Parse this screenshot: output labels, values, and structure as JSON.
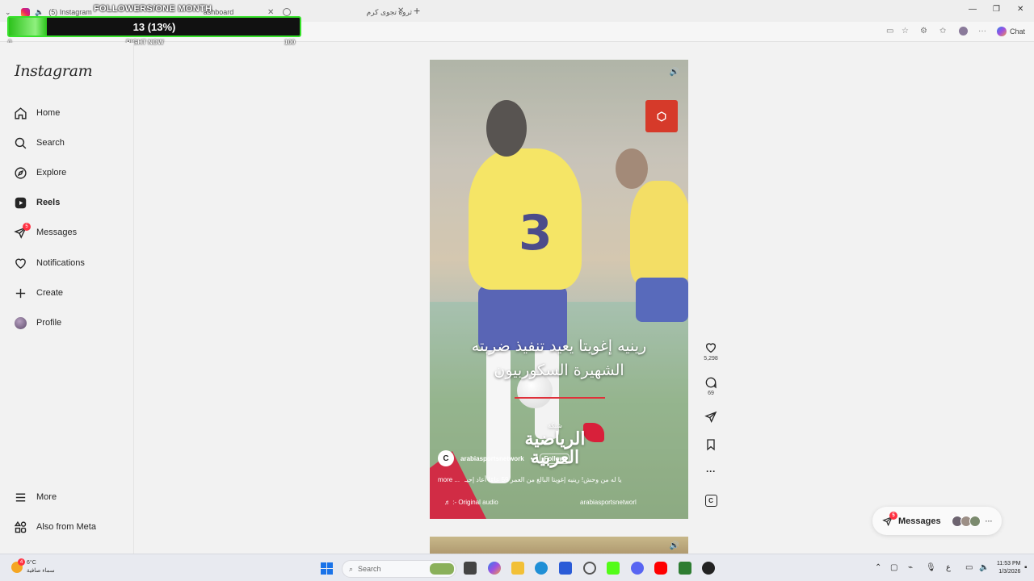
{
  "browser": {
    "tabs": [
      {
        "label": "(5) Instagram"
      },
      {
        "label": "ashboard"
      },
      {
        "label": "ثروة تجوى كرم"
      }
    ],
    "new_tab": "+",
    "address_bar_right": {
      "chat_label": "Chat"
    }
  },
  "overlay": {
    "title": "FOLLOWERS/ONE MONTH",
    "progress_text": "13 (13%)",
    "progress_fraction": 0.13,
    "min_label": "0",
    "center_label": "RIGHT NOW",
    "max_label": "100",
    "colors": {
      "fill": "#37e12b",
      "track": "#111111"
    }
  },
  "sidebar": {
    "logo": "Instagram",
    "items": [
      {
        "label": "Home",
        "icon": "home-icon"
      },
      {
        "label": "Search",
        "icon": "search-icon"
      },
      {
        "label": "Explore",
        "icon": "compass-icon"
      },
      {
        "label": "Reels",
        "icon": "reels-icon"
      },
      {
        "label": "Messages",
        "icon": "messenger-icon",
        "badge": "5"
      },
      {
        "label": "Notifications",
        "icon": "heart-icon"
      },
      {
        "label": "Create",
        "icon": "plus-icon"
      },
      {
        "label": "Profile",
        "icon": "profile-avatar"
      }
    ],
    "bottom": [
      {
        "label": "More",
        "icon": "menu-icon"
      },
      {
        "label": "Also from Meta",
        "icon": "meta-apps-icon"
      }
    ]
  },
  "reel": {
    "caption_line1": "رينيه إغويتا يعيد تنفيذ ضربته",
    "caption_line2": "الشهيرة السكوربيون",
    "brand_small": "شبكة",
    "brand_line1": "الرياضية",
    "brand_line2": "العربية",
    "account": "arabiasportsnetwork",
    "follow_sep": "•",
    "follow": "Follow",
    "description": "يا له من وحش! رينيه إغويتا البالغ من العمر 59 عامًا أعاد إحيـ",
    "more": "more ...",
    "audio": "♬ :- Original audio",
    "audio_account": "arabiasportsnetworl"
  },
  "actions": {
    "likes": "5,298",
    "comments": "69"
  },
  "messages_pill": {
    "label": "Messages",
    "badge": "5",
    "more": "···"
  },
  "taskbar": {
    "weather_temp": "6°C",
    "weather_desc": "سماء صافية",
    "weather_badge": "4",
    "search_placeholder": "Search",
    "lang": "ع",
    "time": "11:53 PM",
    "date": "1/3/2026"
  }
}
